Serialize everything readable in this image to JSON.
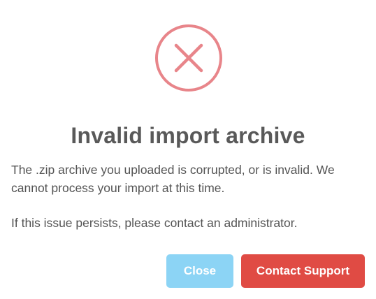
{
  "dialog": {
    "icon": "error-x-circle-icon",
    "title": "Invalid import archive",
    "message_line1": "The .zip archive you uploaded is corrupted, or is invalid. We cannot process your import at this time.",
    "message_line2": "If this issue persists, please contact an administrator.",
    "buttons": {
      "close_label": "Close",
      "support_label": "Contact Support"
    },
    "colors": {
      "error_icon": "#e8858a",
      "close_button": "#8cd4f5",
      "support_button": "#e04b44",
      "title_text": "#595959",
      "body_text": "#545454"
    }
  }
}
